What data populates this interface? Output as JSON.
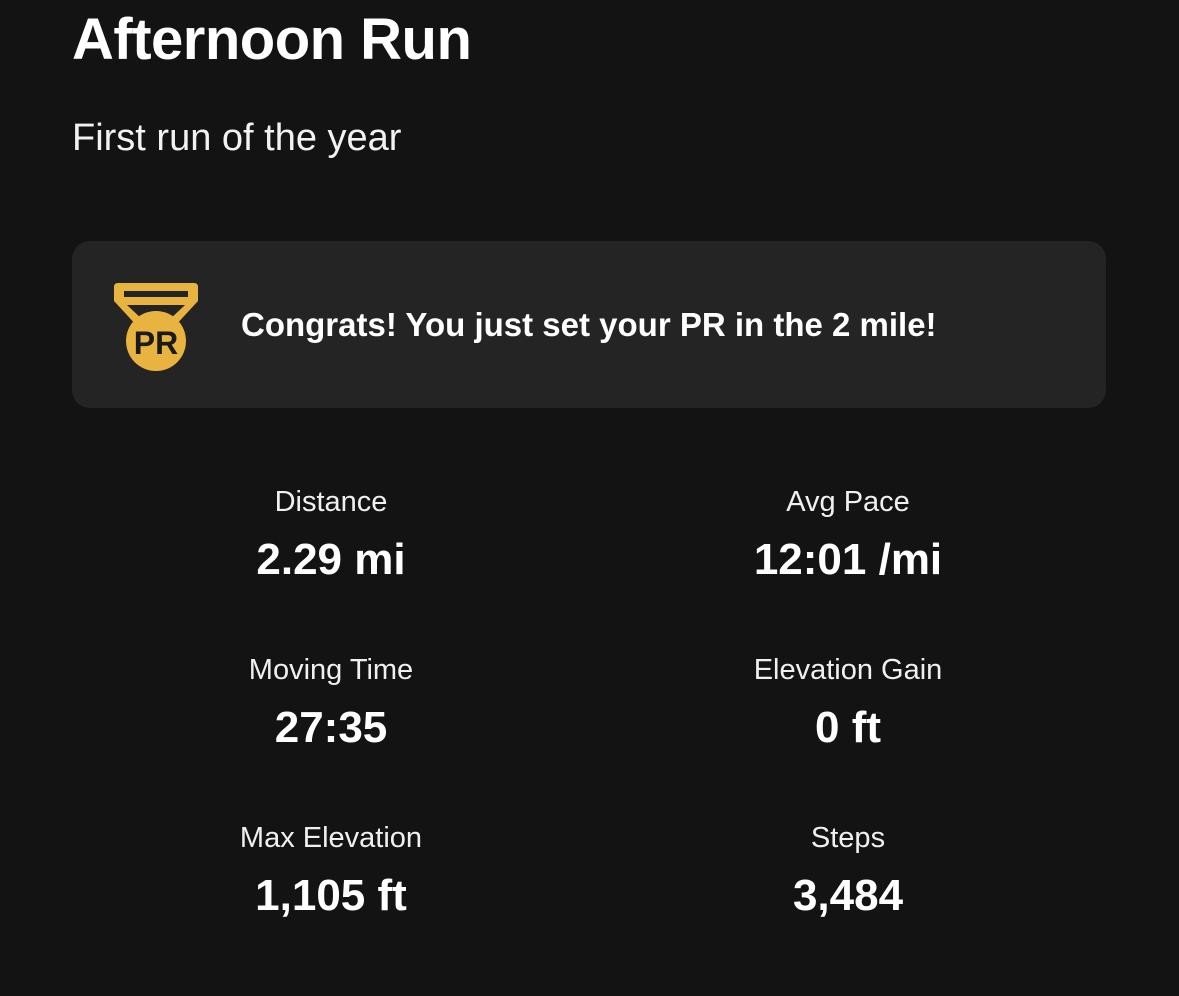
{
  "activity": {
    "title": "Afternoon Run",
    "description": "First run of the year"
  },
  "achievement": {
    "icon": "pr-medal-icon",
    "badge_text": "PR",
    "message": "Congrats! You just set your PR in the 2 mile!",
    "accent_color": "#E8B33E"
  },
  "stats": [
    {
      "label": "Distance",
      "value": "2.29 mi"
    },
    {
      "label": "Avg Pace",
      "value": "12:01 /mi"
    },
    {
      "label": "Moving Time",
      "value": "27:35"
    },
    {
      "label": "Elevation Gain",
      "value": "0 ft"
    },
    {
      "label": "Max Elevation",
      "value": "1,105 ft"
    },
    {
      "label": "Steps",
      "value": "3,484"
    }
  ]
}
